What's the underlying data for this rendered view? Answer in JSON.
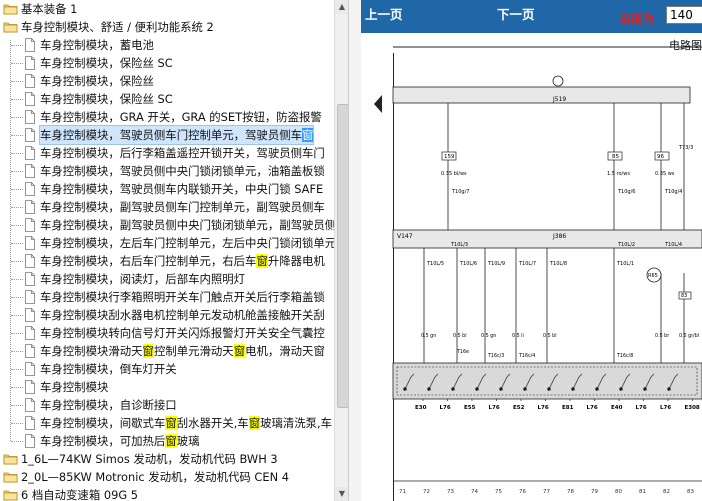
{
  "tree": {
    "items": [
      {
        "level": 0,
        "type": "folder",
        "label": "基本装备 1"
      },
      {
        "level": 0,
        "type": "folder",
        "label": "车身控制模块、舒适 / 便利功能系统 2",
        "open": true
      },
      {
        "level": 1,
        "type": "doc",
        "label": "车身控制模块，蓄电池"
      },
      {
        "level": 1,
        "type": "doc",
        "label": "车身控制模块，保险丝 SC"
      },
      {
        "level": 1,
        "type": "doc",
        "label": "车身控制模块，保险丝"
      },
      {
        "level": 1,
        "type": "doc",
        "label": "车身控制模块，保险丝 SC"
      },
      {
        "level": 1,
        "type": "doc",
        "label": "车身控制模块，GRA 开关，GRA 的SET按钮，防盗报警"
      },
      {
        "level": 1,
        "type": "doc",
        "label": "车身控制模块，驾驶员侧车门控制单元，驾驶员侧车",
        "hl": "窗",
        "after": "",
        "selected": true
      },
      {
        "level": 1,
        "type": "doc",
        "label": "车身控制模块，后行李箱盖遥控开锁开关，驾驶员侧车门"
      },
      {
        "level": 1,
        "type": "doc",
        "label": "车身控制模块，驾驶员侧中央门锁闭锁单元，油箱盖板锁"
      },
      {
        "level": 1,
        "type": "doc",
        "label": "车身控制模块，驾驶员侧车内联锁开关，中央门锁 SAFE"
      },
      {
        "level": 1,
        "type": "doc",
        "label": "车身控制模块，副驾驶员侧车门控制单元，副驾驶员侧车"
      },
      {
        "level": 1,
        "type": "doc",
        "label": "车身控制模块，副驾驶员侧中央门锁闭锁单元，副驾驶员侧"
      },
      {
        "level": 1,
        "type": "doc",
        "label": "车身控制模块，左后车门控制单元，左后中央门锁闭锁单元"
      },
      {
        "level": 1,
        "type": "doc",
        "label": "车身控制模块，右后车门控制单元，右后车",
        "hl": "窗",
        "after": "升降器电机"
      },
      {
        "level": 1,
        "type": "doc",
        "label": "车身控制模块，阅读灯，后部车内照明灯"
      },
      {
        "level": 1,
        "type": "doc",
        "label": "车身控制模块行李箱照明开关车门触点开关后行李箱盖锁"
      },
      {
        "level": 1,
        "type": "doc",
        "label": "车身控制模块刮水器电机控制单元发动机舱盖接触开关刮"
      },
      {
        "level": 1,
        "type": "doc",
        "label": "车身控制模块转向信号灯开关闪烁报警灯开关安全气囊控"
      },
      {
        "level": 1,
        "type": "doc",
        "label": "车身控制模块滑动天",
        "hl": "窗",
        "after": "控制单元滑动天",
        "hl2": "窗",
        "after2": "电机，滑动天窗"
      },
      {
        "level": 1,
        "type": "doc",
        "label": "车身控制模块，倒车灯开关"
      },
      {
        "level": 1,
        "type": "doc",
        "label": "车身控制模块"
      },
      {
        "level": 1,
        "type": "doc",
        "label": "车身控制模块，自诊断接口"
      },
      {
        "level": 1,
        "type": "doc",
        "label": "车身控制模块，间歇式车",
        "hl": "窗",
        "after": "刮水器开关,车",
        "hl2": "窗",
        "after2": "玻璃清洗泵,车"
      },
      {
        "level": 1,
        "type": "doc",
        "label": "车身控制模块，可加热后",
        "hl": "窗",
        "after": "玻璃"
      },
      {
        "level": 0,
        "type": "folder",
        "label": "1_6L—74KW Simos 发动机，发动机代码  BWH 3"
      },
      {
        "level": 0,
        "type": "folder",
        "label": "2_0L—85KW Motronic 发动机，发动机代码  CEN 4"
      },
      {
        "level": 0,
        "type": "folder",
        "label": "6 档自动变速箱  09G 5"
      }
    ]
  },
  "viewer": {
    "prev_label": "上一页",
    "next_label": "下一页",
    "current_label": "当前为",
    "page_value": "140",
    "doc_title": "电路图"
  },
  "diagram": {
    "component_top": "J519",
    "component_mid_left": "V147",
    "component_mid": "J386",
    "wire_labels": [
      "159",
      "85",
      "T73/3",
      "0.35 bl/ws",
      "1.5 ro/ws",
      "0.35 ws",
      "T10g/7",
      "T10g/6",
      "T10g/4",
      "T10L/3",
      "T10L/2",
      "T10L/4",
      "T10L/5",
      "T10L/6",
      "T10L/9",
      "T10L/7",
      "T10L/8",
      "T10L/1",
      "R65",
      "T16e",
      "T16c/3",
      "T16c/4",
      "T16c/8",
      "83",
      "0.5 ws",
      "0.35",
      "0.5 gr/bl",
      "0.5 br",
      "0.5 bl",
      "0.5 gn",
      "0.5 li"
    ],
    "bottom_codes": [
      "E30",
      "L76",
      "E55",
      "L76",
      "E52",
      "L76",
      "E81",
      "L76",
      "E40",
      "L76",
      "L76",
      "E308"
    ],
    "column_numbers": [
      "71",
      "72",
      "73",
      "74",
      "75",
      "76",
      "77",
      "78",
      "79",
      "80",
      "81",
      "82",
      "83"
    ],
    "colors": {
      "topbar": "#1f67a6",
      "highlight": "#ffff00",
      "selected_highlight": "#3399ff",
      "current_label": "#e02020"
    }
  }
}
